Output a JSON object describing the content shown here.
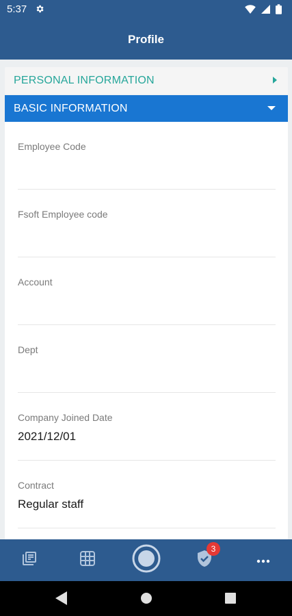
{
  "status_bar": {
    "time": "5:37",
    "icons": [
      "gear-icon",
      "wifi-icon",
      "cell-signal-icon",
      "battery-icon"
    ]
  },
  "app_bar": {
    "title": "Profile"
  },
  "accordion": {
    "personal": {
      "label": "PERSONAL INFORMATION",
      "state": "collapsed",
      "color": "#26a69a"
    },
    "basic": {
      "label": "BASIC INFORMATION",
      "state": "expanded",
      "color": "#1976d2"
    }
  },
  "fields": [
    {
      "label": "Employee Code",
      "value": ""
    },
    {
      "label": "Fsoft Employee code",
      "value": ""
    },
    {
      "label": "Account",
      "value": ""
    },
    {
      "label": "Dept",
      "value": ""
    },
    {
      "label": "Company Joined Date",
      "value": "2021/12/01"
    },
    {
      "label": "Contract",
      "value": "Regular staff"
    }
  ],
  "bottom_nav": {
    "items": [
      "news-icon",
      "grid-icon",
      "home-circle-icon",
      "shield-check-icon",
      "more-icon"
    ],
    "badge_count": "3"
  },
  "system_nav": {
    "items": [
      "back-icon",
      "home-icon",
      "recents-icon"
    ]
  },
  "colors": {
    "primary": "#2d5b8f",
    "accent": "#1976d2",
    "teal": "#26a69a",
    "badge": "#e53935"
  }
}
